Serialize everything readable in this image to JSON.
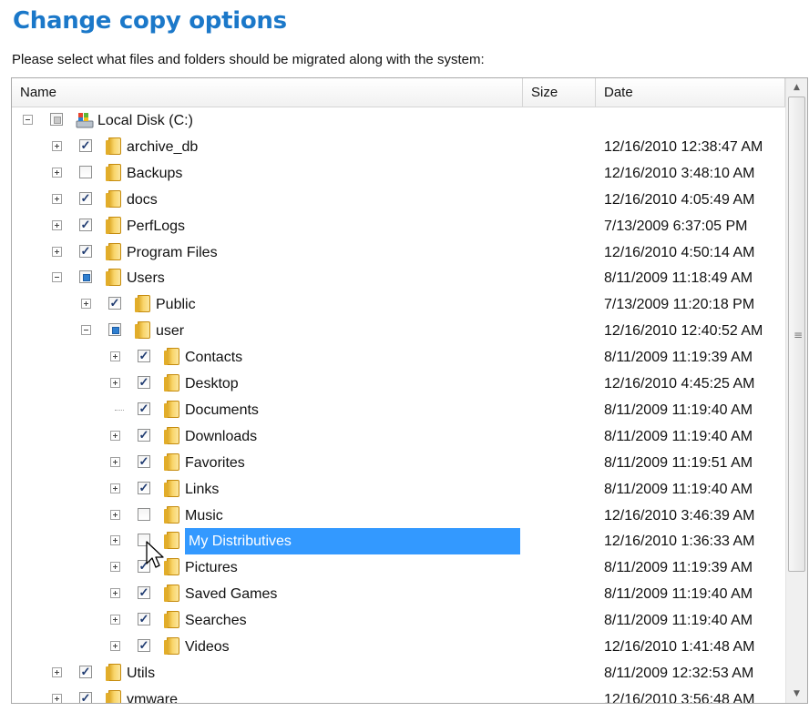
{
  "page": {
    "title": "Change copy options",
    "subtitle": "Please select what files and folders should be migrated along with the system:"
  },
  "columns": {
    "name": "Name",
    "size": "Size",
    "date": "Date"
  },
  "tree": [
    {
      "level": 0,
      "expander": "minus",
      "check": "ind",
      "icon": "disk",
      "name": "Local Disk (C:)",
      "date": ""
    },
    {
      "level": 1,
      "expander": "plus",
      "check": "checked",
      "icon": "folder",
      "name": "archive_db",
      "date": "12/16/2010 12:38:47 AM"
    },
    {
      "level": 1,
      "expander": "plus",
      "check": "none",
      "icon": "folder",
      "name": "Backups",
      "date": "12/16/2010 3:48:10 AM"
    },
    {
      "level": 1,
      "expander": "plus",
      "check": "checked",
      "icon": "folder",
      "name": "docs",
      "date": "12/16/2010 4:05:49 AM"
    },
    {
      "level": 1,
      "expander": "plus",
      "check": "checked",
      "icon": "folder",
      "name": "PerfLogs",
      "date": "7/13/2009 6:37:05 PM"
    },
    {
      "level": 1,
      "expander": "plus",
      "check": "checked",
      "icon": "folder",
      "name": "Program Files",
      "date": "12/16/2010 4:50:14 AM"
    },
    {
      "level": 1,
      "expander": "minus",
      "check": "partial",
      "icon": "folder",
      "name": "Users",
      "date": "8/11/2009 11:18:49 AM"
    },
    {
      "level": 2,
      "expander": "plus",
      "check": "checked",
      "icon": "folder",
      "name": "Public",
      "date": "7/13/2009 11:20:18 PM"
    },
    {
      "level": 2,
      "expander": "minus",
      "check": "partial",
      "icon": "folder",
      "name": "user",
      "date": "12/16/2010 12:40:52 AM"
    },
    {
      "level": 3,
      "expander": "plus",
      "check": "checked",
      "icon": "folder",
      "name": "Contacts",
      "date": "8/11/2009 11:19:39 AM"
    },
    {
      "level": 3,
      "expander": "plus",
      "check": "checked",
      "icon": "folder",
      "name": "Desktop",
      "date": "12/16/2010 4:45:25 AM"
    },
    {
      "level": 3,
      "expander": "none",
      "check": "checked",
      "icon": "folder",
      "name": "Documents",
      "date": "8/11/2009 11:19:40 AM"
    },
    {
      "level": 3,
      "expander": "plus",
      "check": "checked",
      "icon": "folder",
      "name": "Downloads",
      "date": "8/11/2009 11:19:40 AM"
    },
    {
      "level": 3,
      "expander": "plus",
      "check": "checked",
      "icon": "folder",
      "name": "Favorites",
      "date": "8/11/2009 11:19:51 AM"
    },
    {
      "level": 3,
      "expander": "plus",
      "check": "checked",
      "icon": "folder",
      "name": "Links",
      "date": "8/11/2009 11:19:40 AM"
    },
    {
      "level": 3,
      "expander": "plus",
      "check": "none",
      "icon": "folder",
      "name": "Music",
      "date": "12/16/2010 3:46:39 AM"
    },
    {
      "level": 3,
      "expander": "plus",
      "check": "none",
      "icon": "folder",
      "name": "My Distributives",
      "date": "12/16/2010 1:36:33 AM",
      "selected": true
    },
    {
      "level": 3,
      "expander": "plus",
      "check": "checked",
      "icon": "folder",
      "name": "Pictures",
      "date": "8/11/2009 11:19:39 AM"
    },
    {
      "level": 3,
      "expander": "plus",
      "check": "checked",
      "icon": "folder",
      "name": "Saved Games",
      "date": "8/11/2009 11:19:40 AM"
    },
    {
      "level": 3,
      "expander": "plus",
      "check": "checked",
      "icon": "folder",
      "name": "Searches",
      "date": "8/11/2009 11:19:40 AM"
    },
    {
      "level": 3,
      "expander": "plus",
      "check": "checked",
      "icon": "folder",
      "name": "Videos",
      "date": "12/16/2010 1:41:48 AM"
    },
    {
      "level": 1,
      "expander": "plus",
      "check": "checked",
      "icon": "folder",
      "name": "Utils",
      "date": "8/11/2009 12:32:53 AM"
    },
    {
      "level": 1,
      "expander": "plus",
      "check": "checked",
      "icon": "folder",
      "name": "vmware",
      "date": "12/16/2010 3:56:48 AM"
    }
  ],
  "scrollbar": {
    "up": "▲",
    "down": "▼",
    "grip": "≡"
  }
}
